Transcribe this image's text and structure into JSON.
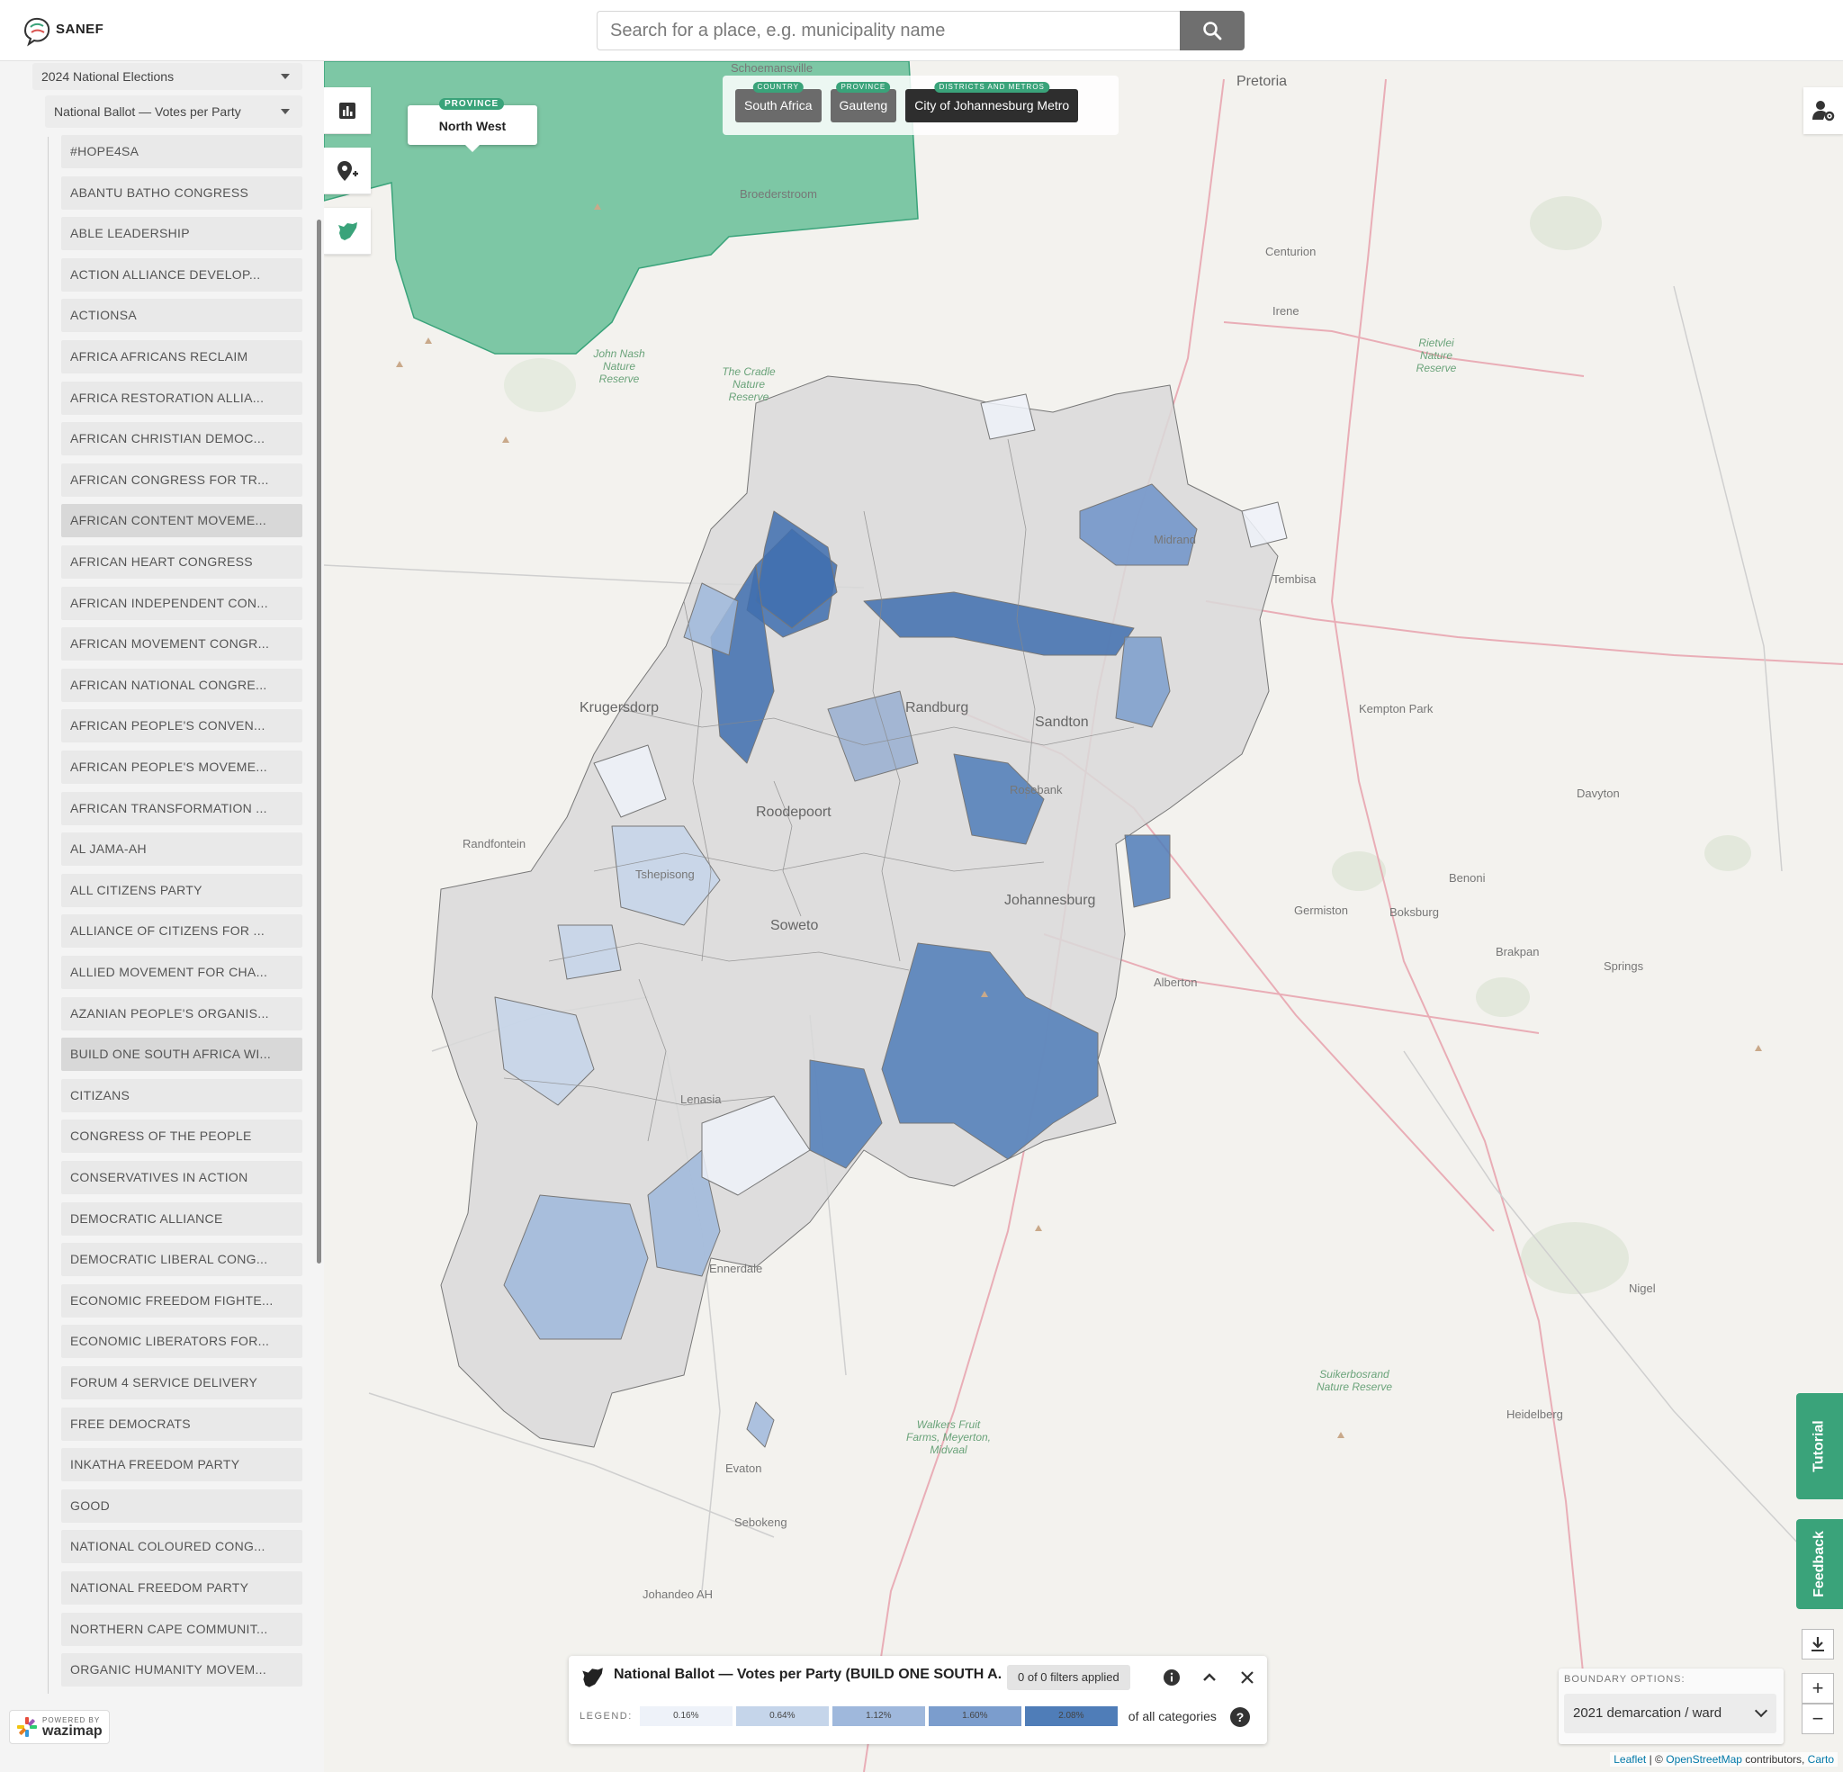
{
  "header": {
    "logo_text": "SANEF",
    "search_placeholder": "Search for a place, e.g. municipality name"
  },
  "sidebar": {
    "election_dropdown": "2024 National Elections",
    "ballot_dropdown": "National Ballot — Votes per Party",
    "parties": [
      "#HOPE4SA",
      "ABANTU BATHO CONGRESS",
      "ABLE LEADERSHIP",
      "ACTION ALLIANCE DEVELOP...",
      "ACTIONSA",
      "AFRICA AFRICANS RECLAIM",
      "AFRICA RESTORATION ALLIA...",
      "AFRICAN CHRISTIAN DEMOC...",
      "AFRICAN CONGRESS FOR TR...",
      "AFRICAN CONTENT MOVEME...",
      "AFRICAN HEART CONGRESS",
      "AFRICAN INDEPENDENT CON...",
      "AFRICAN MOVEMENT CONGR...",
      "AFRICAN NATIONAL CONGRE...",
      "AFRICAN PEOPLE'S CONVEN...",
      "AFRICAN PEOPLE'S MOVEME...",
      "AFRICAN TRANSFORMATION ...",
      "AL JAMA-AH",
      "ALL CITIZENS PARTY",
      "ALLIANCE OF CITIZENS FOR ...",
      "ALLIED MOVEMENT FOR CHA...",
      "AZANIAN PEOPLE'S ORGANIS...",
      "BUILD ONE SOUTH AFRICA WI...",
      "CITIZANS",
      "CONGRESS OF THE PEOPLE",
      "CONSERVATIVES IN ACTION",
      "DEMOCRATIC ALLIANCE",
      "DEMOCRATIC LIBERAL CONG...",
      "ECONOMIC FREEDOM FIGHTE...",
      "ECONOMIC LIBERATORS FOR...",
      "FORUM 4 SERVICE DELIVERY",
      "FREE DEMOCRATS",
      "INKATHA FREEDOM PARTY",
      "GOOD",
      "NATIONAL COLOURED CONG...",
      "NATIONAL FREEDOM PARTY",
      "NORTHERN CAPE COMMUNIT...",
      "ORGANIC HUMANITY MOVEM..."
    ],
    "highlighted": [
      9,
      22
    ],
    "powered_by_small": "POWERED BY",
    "powered_by_brand": "wazimap"
  },
  "map": {
    "tooltip_tag": "PROVINCE",
    "tooltip_name": "North West",
    "breadcrumbs": [
      {
        "tag": "COUNTRY",
        "label": "South Africa"
      },
      {
        "tag": "PROVINCE",
        "label": "Gauteng"
      },
      {
        "tag": "DISTRICTS AND METROS",
        "label": "City of Johannesburg Metro"
      }
    ],
    "place_labels": {
      "pretoria": "Pretoria",
      "centurion": "Centurion",
      "irene": "Irene",
      "krugersdorp": "Krugersdorp",
      "randburg": "Randburg",
      "sandton": "Sandton",
      "roodepoort": "Roodepoort",
      "johannesburg": "Johannesburg",
      "soweto": "Soweto",
      "lenasia": "Lenasia",
      "ennerdale": "Ennerdale",
      "evaton": "Evaton",
      "sebokeng": "Sebokeng",
      "johandeo": "Johandeo AH",
      "randfontein": "Randfontein",
      "kempton": "Kempton Park",
      "tembisa": "Tembisa",
      "benoni": "Benoni",
      "boksburg": "Boksburg",
      "germiston": "Germiston",
      "brakpan": "Brakpan",
      "springs": "Springs",
      "alberton": "Alberton",
      "heidelberg": "Heidelberg",
      "nigel": "Nigel",
      "broederstroom": "Broederstroom",
      "schoemansville": "Schoemansville",
      "midrand": "Midrand",
      "davyton": "Davyton",
      "rosebank": "Rosebank",
      "tshepisong": "Tshepisong",
      "suikerbosrand": "Suikerbosrand Nature Reserve",
      "john_nash": "John Nash Nature Reserve",
      "cradle": "The Cradle Nature Reserve",
      "rietvlei": "Rietvlei Nature Reserve",
      "walkers": "Walkers Fruit Farms, Meyerton, Midvaal"
    }
  },
  "right": {
    "tutorial": "Tutorial",
    "feedback": "Feedback",
    "zoom_in": "+",
    "zoom_out": "−"
  },
  "boundary": {
    "title": "BOUNDARY OPTIONS:",
    "value": "2021 demarcation / ward"
  },
  "legend": {
    "title": "National Ballot — Votes per Party (BUILD ONE SOUTH A...",
    "filters": "0 of 0 filters applied",
    "label": "LEGEND:",
    "stops": [
      "0.16%",
      "0.64%",
      "1.12%",
      "1.60%",
      "2.08%"
    ],
    "colors": [
      "#eef2f9",
      "#c5d5ea",
      "#9fb8dc",
      "#7b9dcd",
      "#4f7db8"
    ],
    "suffix": "of all categories"
  },
  "attribution": {
    "leaflet": "Leaflet",
    "sep": " | © ",
    "osm": "OpenStreetMap",
    "contrib": " contributors, ",
    "carto": "Carto"
  }
}
